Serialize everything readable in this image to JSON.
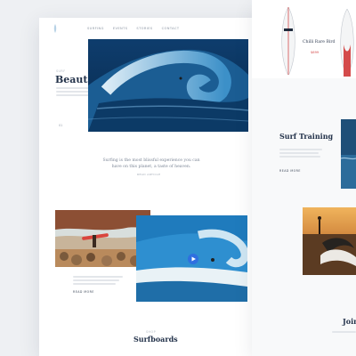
{
  "nav": {
    "items": [
      "Surfing",
      "Events",
      "Stories",
      "Contact"
    ]
  },
  "hero": {
    "eyebrow": "Surf",
    "title": "Beautiful Escape",
    "page_indicator": "01"
  },
  "quote": {
    "text": "Surfing is the most blissful experience you can have on this planet, a taste of heaven.",
    "link": "Read article"
  },
  "feature": {
    "button": "Read more"
  },
  "surfboards": {
    "eyebrow": "Shop",
    "title": "Surfboards"
  },
  "right": {
    "product": {
      "name": "Chilli Rare Bird",
      "price": "$699"
    },
    "training": {
      "title": "Surf Training",
      "button": "Read more"
    },
    "join": {
      "title": "Join"
    }
  },
  "colors": {
    "navy": "#23324a",
    "accent": "#d44b4b",
    "ocean": "#2a6fb3"
  }
}
